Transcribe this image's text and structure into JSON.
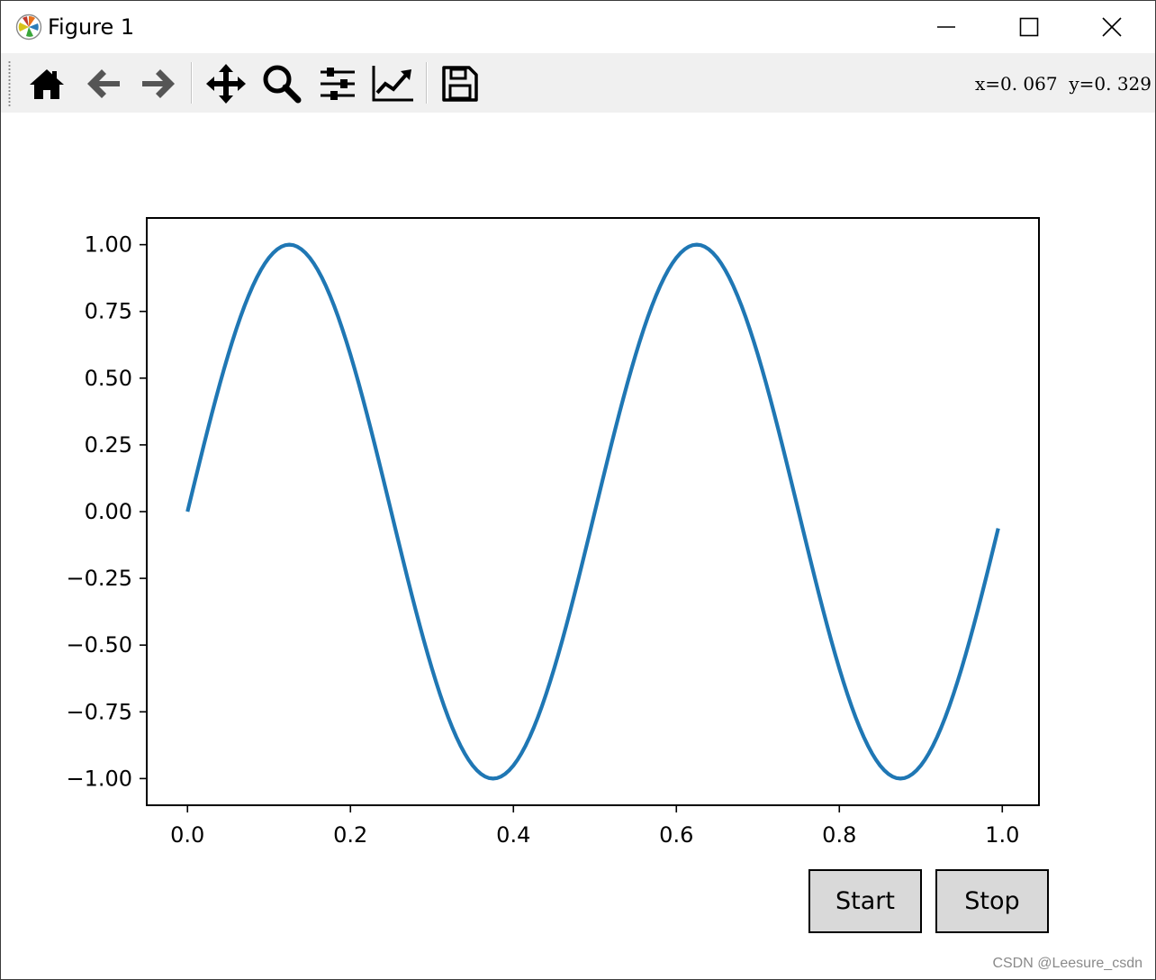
{
  "window": {
    "title": "Figure 1"
  },
  "toolbar": {
    "tools": [
      {
        "name": "home-icon"
      },
      {
        "name": "back-arrow-icon"
      },
      {
        "name": "forward-arrow-icon"
      },
      {
        "name": "pan-icon"
      },
      {
        "name": "zoom-icon"
      },
      {
        "name": "configure-subplots-icon"
      },
      {
        "name": "edit-axis-icon"
      },
      {
        "name": "save-icon"
      }
    ],
    "coords": "x=0. 067  y=0. 329"
  },
  "buttons": {
    "start": "Start",
    "stop": "Stop"
  },
  "watermark": "CSDN @Leesure_csdn",
  "colors": {
    "line": "#1f77b4",
    "button_bg": "#d9d9d9",
    "toolbar_bg": "#f0f0f0"
  },
  "chart_data": {
    "type": "line",
    "title": "",
    "xlabel": "",
    "ylabel": "",
    "xlim": [
      -0.05,
      1.045
    ],
    "ylim": [
      -1.1,
      1.1
    ],
    "x_ticks": [
      0.0,
      0.2,
      0.4,
      0.6,
      0.8,
      1.0
    ],
    "x_tick_labels": [
      "0.0",
      "0.2",
      "0.4",
      "0.6",
      "0.8",
      "1.0"
    ],
    "y_ticks": [
      1.0,
      0.75,
      0.5,
      0.25,
      0.0,
      -0.25,
      -0.5,
      -0.75,
      -1.0
    ],
    "y_tick_labels": [
      "1.00",
      "0.75",
      "0.50",
      "0.25",
      "0.00",
      "−0.25",
      "−0.50",
      "−0.75",
      "−1.00"
    ],
    "grid": false,
    "series": [
      {
        "function": "sin(2*pi*2*x)",
        "x_start": 0.0,
        "x_end": 0.995,
        "step": 0.005,
        "color": "#1f77b4"
      }
    ]
  }
}
